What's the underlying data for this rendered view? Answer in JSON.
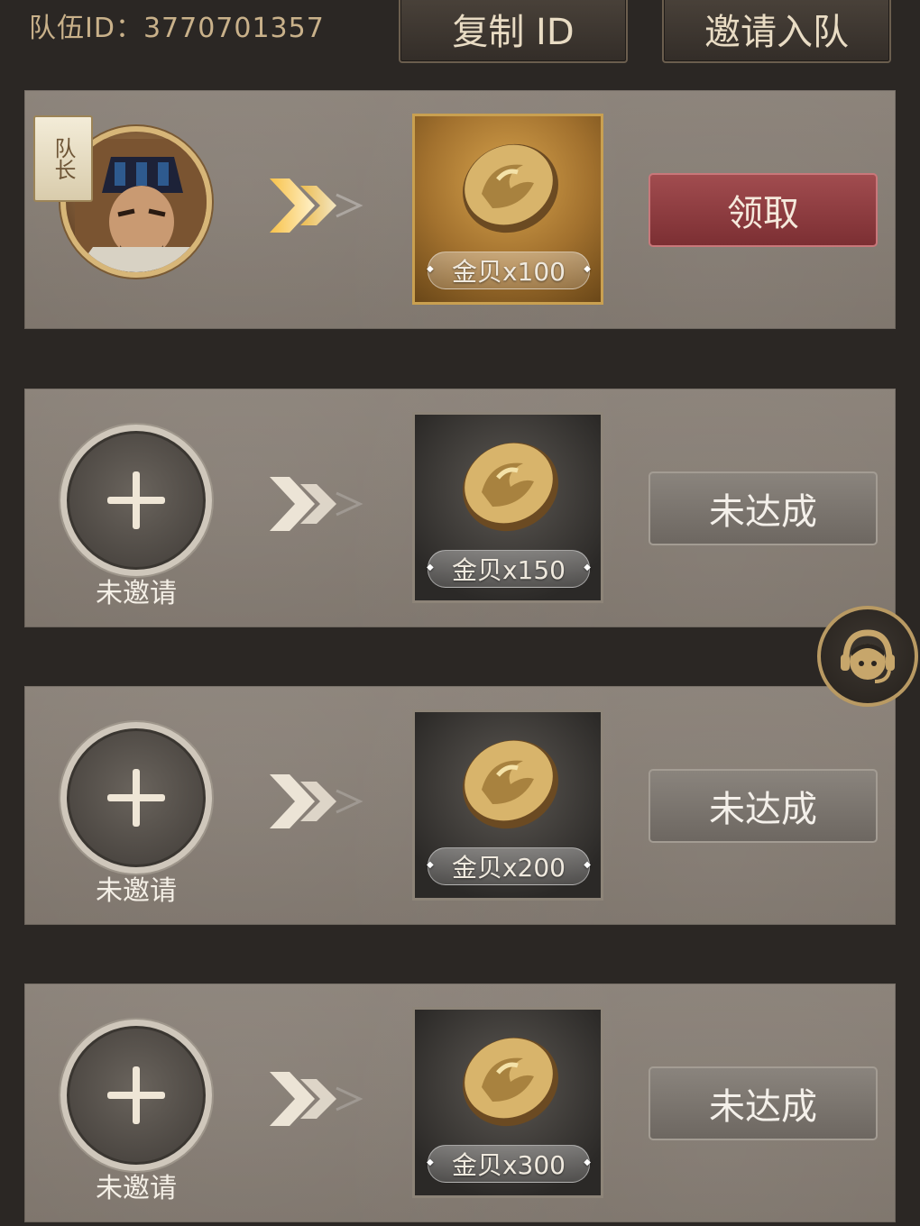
{
  "header": {
    "team_id_label": "队伍ID：3770701357",
    "copy_id_label": "复制 ID",
    "invite_label": "邀请入队"
  },
  "rows": [
    {
      "slot": "leader",
      "leader_badge": "队长",
      "reward": "金贝x100",
      "action": "领取",
      "state": "claimable"
    },
    {
      "slot": "empty",
      "status": "未邀请",
      "reward": "金贝x150",
      "action": "未达成",
      "state": "locked"
    },
    {
      "slot": "empty",
      "status": "未邀请",
      "reward": "金贝x200",
      "action": "未达成",
      "state": "locked"
    },
    {
      "slot": "empty",
      "status": "未邀请",
      "reward": "金贝x300",
      "action": "未达成",
      "state": "locked"
    }
  ],
  "icons": {
    "coin": "gold-shell-coin-icon",
    "plus": "plus-icon",
    "chevron": "double-chevron-icon",
    "support": "customer-service-icon"
  },
  "colors": {
    "claim_button": "#8e3b3f",
    "pending_button": "#7b756f",
    "gold_frame": "#c9a050",
    "row_bg": "#847b72"
  }
}
